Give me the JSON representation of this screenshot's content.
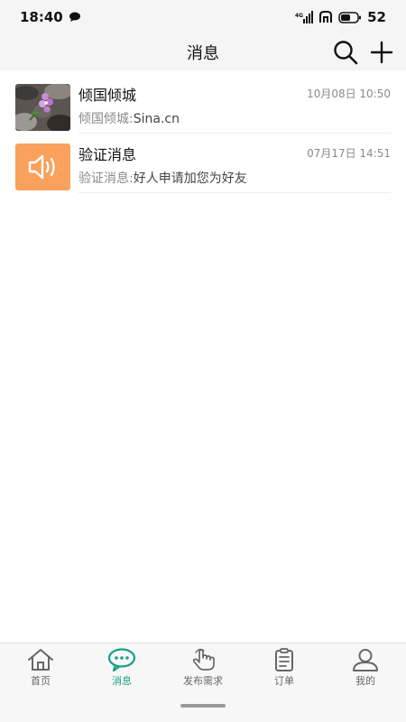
{
  "status_bar": {
    "time": "18:40",
    "signal_label": "4G",
    "battery": "52"
  },
  "header": {
    "title": "消息"
  },
  "conversations": [
    {
      "name": "倾国倾城",
      "time": "10月08日 10:50",
      "preview_label": "倾国倾城:",
      "preview_text": "Sina.cn",
      "avatar": "flower-photo"
    },
    {
      "name": "验证消息",
      "time": "07月17日 14:51",
      "preview_label": "验证消息:",
      "preview_text": "好人申请加您为好友",
      "avatar": "speaker-icon",
      "avatar_color": "#f9a15d"
    }
  ],
  "tabbar": {
    "tabs": [
      {
        "label": "首页",
        "icon": "home-icon"
      },
      {
        "label": "消息",
        "icon": "chat-bubble-icon",
        "active": true
      },
      {
        "label": "发布需求",
        "icon": "hand-pointer-icon"
      },
      {
        "label": "订单",
        "icon": "clipboard-icon"
      },
      {
        "label": "我的",
        "icon": "user-icon"
      }
    ],
    "active_color": "#16a085"
  }
}
